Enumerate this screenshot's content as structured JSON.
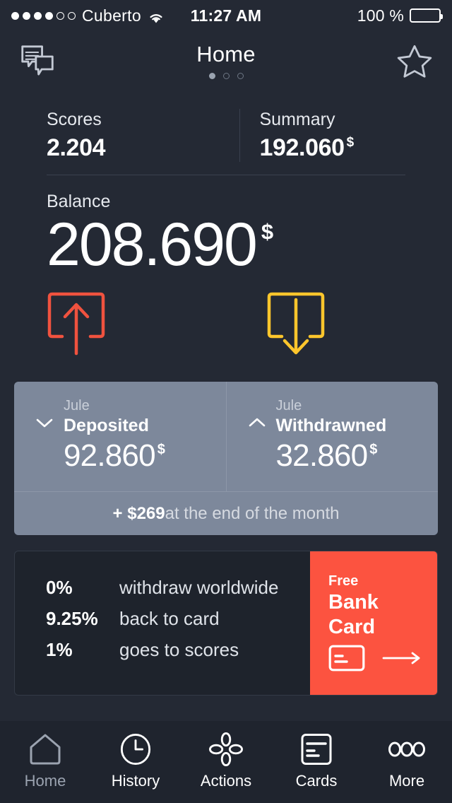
{
  "statusbar": {
    "carrier": "Cuberto",
    "signal_filled": 4,
    "signal_empty": 2,
    "wifi_icon": "wifi-icon",
    "time": "11:27 AM",
    "battery_percent": "100 %",
    "battery_level": 100
  },
  "navbar": {
    "title": "Home",
    "left_icon": "chat-bubbles-icon",
    "right_icon": "star-icon",
    "page_dots": {
      "total": 3,
      "active_index": 0
    }
  },
  "stats": {
    "scores": {
      "label": "Scores",
      "value": "2.204",
      "currency": ""
    },
    "summary": {
      "label": "Summary",
      "value": "192.060",
      "currency": "$"
    }
  },
  "balance": {
    "label": "Balance",
    "value": "208.690",
    "currency": "$"
  },
  "actions": {
    "deposit": {
      "icon": "tray-arrow-up-icon",
      "color": "#f0523f"
    },
    "withdraw": {
      "icon": "tray-arrow-down-icon",
      "color": "#ffc62c"
    }
  },
  "summary_card": {
    "background": "#7d889b",
    "deposited": {
      "month": "Jule",
      "label": "Deposited",
      "value": "92.860",
      "currency": "$",
      "chevron": "chevron-down-icon"
    },
    "withdrawned": {
      "month": "Jule",
      "label": "Withdrawned",
      "value": "32.860",
      "currency": "$",
      "chevron": "chevron-up-icon"
    },
    "footer_amount": "+ $269",
    "footer_text": " at the end of the month"
  },
  "promo": {
    "accent_color": "#fc5340",
    "rows": [
      {
        "percent": "0%",
        "text": "withdraw worldwide"
      },
      {
        "percent": "9.25%",
        "text": "back to card"
      },
      {
        "percent": "1%",
        "text": "goes to scores"
      }
    ],
    "badge_free": "Free",
    "badge_title_line1": "Bank",
    "badge_title_line2": "Card",
    "card_icon": "credit-card-icon",
    "arrow_icon": "arrow-right-icon"
  },
  "tabbar": {
    "items": [
      {
        "label": "Home",
        "icon": "home-icon",
        "active": false
      },
      {
        "label": "History",
        "icon": "clock-icon",
        "active": true
      },
      {
        "label": "Actions",
        "icon": "actions-diamond-icon",
        "active": true
      },
      {
        "label": "Cards",
        "icon": "card-list-icon",
        "active": true
      },
      {
        "label": "More",
        "icon": "ellipsis-icon",
        "active": true
      }
    ]
  }
}
